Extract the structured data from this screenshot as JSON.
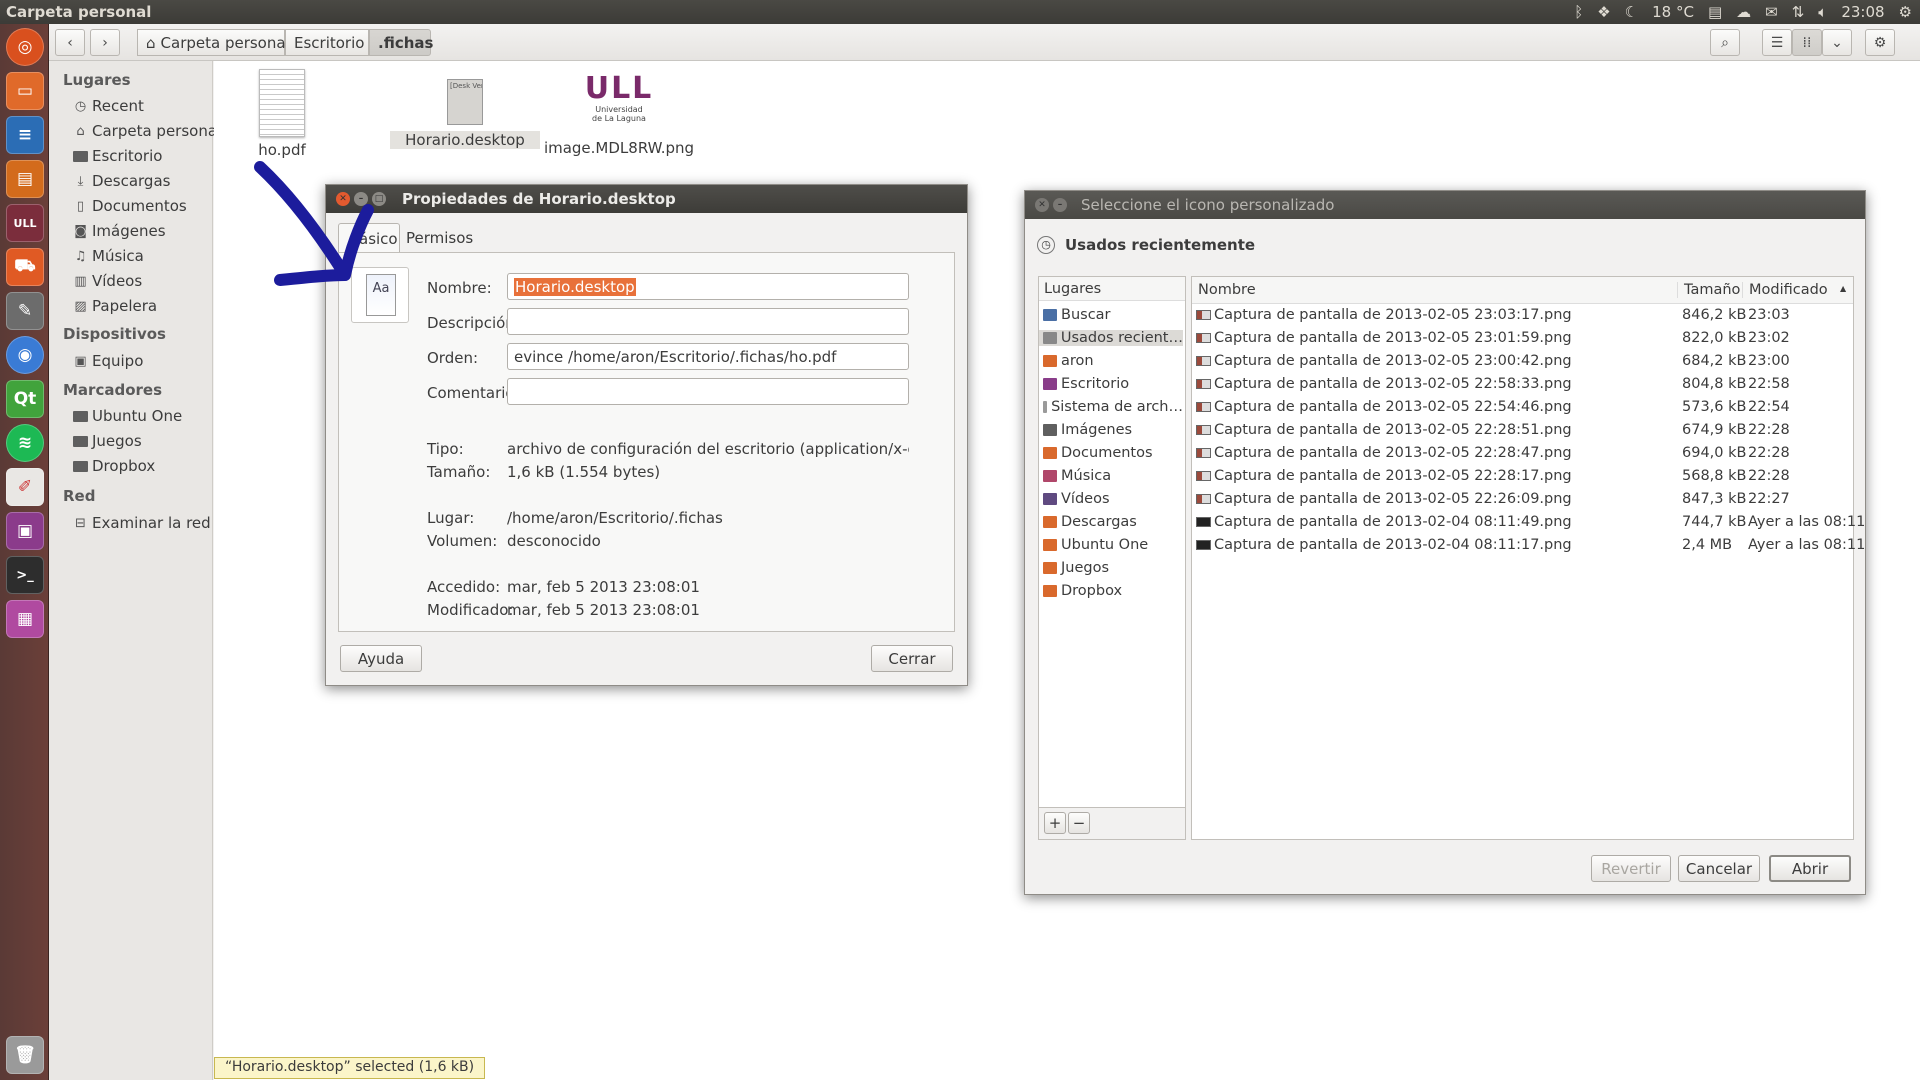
{
  "topbar": {
    "title": "Carpeta personal",
    "temperature": "18 °C",
    "time": "23:08",
    "indicators": [
      "bluetooth-icon",
      "dropbox-icon",
      "weather-icon",
      "keyboard-icon",
      "cloud-icon",
      "mail-icon",
      "network-icon",
      "volume-icon",
      "settings-icon"
    ]
  },
  "launcher": {
    "items": [
      "dash-home",
      "firefox",
      "libreoffice-writer",
      "libreoffice-impress",
      "ull-logo",
      "software-center",
      "gimp",
      "chromium",
      "qt-creator",
      "spotify",
      "text-editor",
      "image-viewer",
      "terminal",
      "workspaces",
      "trash"
    ]
  },
  "nautilus": {
    "breadcrumbs": [
      "Carpeta personal",
      "Escritorio",
      ".fichas"
    ],
    "sidebar": {
      "lugares_header": "Lugares",
      "lugares": [
        "Recent",
        "Carpeta personal",
        "Escritorio",
        "Descargas",
        "Documentos",
        "Imágenes",
        "Música",
        "Vídeos",
        "Papelera"
      ],
      "dispositivos_header": "Dispositivos",
      "dispositivos": [
        "Equipo"
      ],
      "marcadores_header": "Marcadores",
      "marcadores": [
        "Ubuntu One",
        "Juegos",
        "Dropbox"
      ],
      "red_header": "Red",
      "red": [
        "Examinar la red"
      ]
    },
    "files": [
      {
        "name": "ho.pdf",
        "icon": "pdf-icon"
      },
      {
        "name": "Horario.desktop",
        "icon": "desktop-file-icon"
      },
      {
        "name": "image.MDL8RW.png",
        "icon": "ull-image-icon",
        "thumb_text": "ULL",
        "thumb_caption_1": "Universidad",
        "thumb_caption_2": "de La Laguna"
      }
    ],
    "desktop_thumb_text": "[Desk Versi Name= Gener",
    "status": "“Horario.desktop” selected  (1,6 kB)"
  },
  "properties_dialog": {
    "title": "Propiedades de Horario.desktop",
    "tabs": [
      "Básico",
      "Permisos"
    ],
    "tab_visible_text": "ásico",
    "icon_text": "Aa",
    "fields": {
      "nombre_label": "Nombre:",
      "nombre_value": "Horario.desktop",
      "descripcion_label": "Descripción:",
      "descripcion_value": "",
      "orden_label": "Orden:",
      "orden_value": "evince /home/aron/Escritorio/.fichas/ho.pdf",
      "comentario_label": "Comentario:",
      "comentario_value": ""
    },
    "info": {
      "tipo_label": "Tipo:",
      "tipo_value": "archivo de configuración del escritorio (application/x-des…",
      "tamano_label": "Tamaño:",
      "tamano_value": "1,6 kB (1.554 bytes)",
      "lugar_label": "Lugar:",
      "lugar_value": "/home/aron/Escritorio/.fichas",
      "volumen_label": "Volumen:",
      "volumen_value": "desconocido",
      "accedido_label": "Accedido:",
      "accedido_value": "mar, feb  5 2013 23:08:01",
      "modificado_label": "Modificado:",
      "modificado_value": "mar, feb  5 2013 23:08:01"
    },
    "help_button": "Ayuda",
    "close_button": "Cerrar"
  },
  "icon_chooser": {
    "title": "Seleccione el icono personalizado",
    "recent_label": "Usados recientemente",
    "places_header": "Lugares",
    "places": [
      {
        "label": "Buscar",
        "color": "#4a6fa5"
      },
      {
        "label": "Usados recient…",
        "color": "#888888"
      },
      {
        "label": "aron",
        "color": "#d9692c"
      },
      {
        "label": "Escritorio",
        "color": "#8a3d8a"
      },
      {
        "label": "Sistema de arch…",
        "color": "#9a9a9a"
      },
      {
        "label": "Imágenes",
        "color": "#5f5f5f"
      },
      {
        "label": "Documentos",
        "color": "#d9692c"
      },
      {
        "label": "Música",
        "color": "#b0476a"
      },
      {
        "label": "Vídeos",
        "color": "#5f4a80"
      },
      {
        "label": "Descargas",
        "color": "#d9692c"
      },
      {
        "label": "Ubuntu One",
        "color": "#d9692c"
      },
      {
        "label": "Juegos",
        "color": "#d9692c"
      },
      {
        "label": "Dropbox",
        "color": "#d9692c"
      }
    ],
    "add_button": "+",
    "remove_button": "−",
    "columns": {
      "name": "Nombre",
      "size": "Tamaño",
      "modified": "Modificado",
      "sort_indicator": "▲"
    },
    "rows": [
      {
        "name": "Captura de pantalla de 2013-02-05 23:03:17.png",
        "size": "846,2 kB",
        "modified": "23:03"
      },
      {
        "name": "Captura de pantalla de 2013-02-05 23:01:59.png",
        "size": "822,0 kB",
        "modified": "23:02"
      },
      {
        "name": "Captura de pantalla de 2013-02-05 23:00:42.png",
        "size": "684,2 kB",
        "modified": "23:00"
      },
      {
        "name": "Captura de pantalla de 2013-02-05 22:58:33.png",
        "size": "804,8 kB",
        "modified": "22:58"
      },
      {
        "name": "Captura de pantalla de 2013-02-05 22:54:46.png",
        "size": "573,6 kB",
        "modified": "22:54"
      },
      {
        "name": "Captura de pantalla de 2013-02-05 22:28:51.png",
        "size": "674,9 kB",
        "modified": "22:28"
      },
      {
        "name": "Captura de pantalla de 2013-02-05 22:28:47.png",
        "size": "694,0 kB",
        "modified": "22:28"
      },
      {
        "name": "Captura de pantalla de 2013-02-05 22:28:17.png",
        "size": "568,8 kB",
        "modified": "22:28"
      },
      {
        "name": "Captura de pantalla de 2013-02-05 22:26:09.png",
        "size": "847,3 kB",
        "modified": "22:27"
      },
      {
        "name": "Captura de pantalla de 2013-02-04 08:11:49.png",
        "size": "744,7 kB",
        "modified": "Ayer a las 08:11"
      },
      {
        "name": "Captura de pantalla de 2013-02-04 08:11:17.png",
        "size": "2,4 MB",
        "modified": "Ayer a las 08:11"
      }
    ],
    "buttons": {
      "revert": "Revertir",
      "cancel": "Cancelar",
      "open": "Abrir"
    }
  },
  "annotation": {
    "color": "#1c1c9c"
  }
}
